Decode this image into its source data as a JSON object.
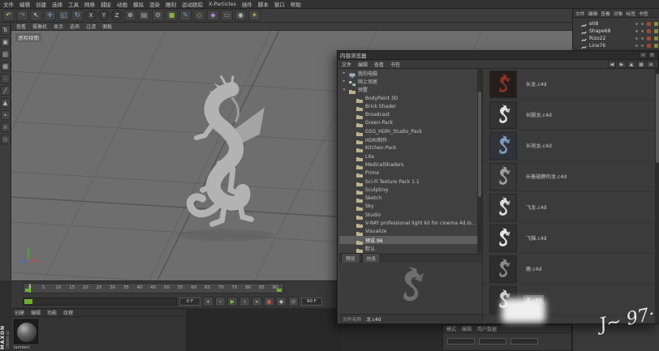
{
  "menubar": {
    "items": [
      "文件",
      "编辑",
      "创建",
      "选择",
      "工具",
      "网格",
      "捕捉",
      "动画",
      "模拟",
      "渲染",
      "雕刻",
      "运动跟踪",
      "X-Particles",
      "插件",
      "脚本",
      "窗口",
      "帮助"
    ]
  },
  "toolbar": {
    "tools": [
      {
        "name": "undo",
        "glyph": "↶",
        "color": "#d6c27a"
      },
      {
        "name": "redo",
        "glyph": "↷",
        "color": "#8f8f8f"
      },
      {
        "name": "live-selection",
        "glyph": "↖",
        "color": "#e2e2e2"
      },
      {
        "name": "move",
        "glyph": "✛",
        "color": "#7fb2e5"
      },
      {
        "name": "scale",
        "glyph": "◱",
        "color": "#7fb2e5"
      },
      {
        "name": "rotate",
        "glyph": "↻",
        "color": "#7fb2e5"
      },
      {
        "name": "axis-x",
        "glyph": "X",
        "color": "#d0d0d0",
        "circle": true
      },
      {
        "name": "axis-y",
        "glyph": "Y",
        "color": "#d0d0d0",
        "circle": true
      },
      {
        "name": "axis-z",
        "glyph": "Z",
        "color": "#d0d0d0",
        "circle": true
      },
      {
        "name": "coordinate-system",
        "glyph": "⊕",
        "color": "#bdbdbd"
      },
      {
        "name": "render-view",
        "glyph": "▤",
        "color": "#aaaaaa"
      },
      {
        "name": "render-settings",
        "glyph": "⚙",
        "color": "#aaaaaa"
      },
      {
        "name": "add-cube",
        "glyph": "■",
        "color": "#86b040"
      },
      {
        "name": "add-spline",
        "glyph": "✎",
        "color": "#6f9fd8"
      },
      {
        "name": "add-generator",
        "glyph": "◇",
        "color": "#86b040"
      },
      {
        "name": "add-deformer",
        "glyph": "◆",
        "color": "#b07fd8"
      },
      {
        "name": "add-floor",
        "glyph": "▭",
        "color": "#b08f5a"
      },
      {
        "name": "add-camera",
        "glyph": "◉",
        "color": "#bdbdbd"
      },
      {
        "name": "add-light",
        "glyph": "☀",
        "color": "#e0c76a"
      }
    ]
  },
  "left_toolbar": {
    "tools": [
      {
        "name": "make-editable",
        "glyph": "⇅"
      },
      {
        "name": "model-mode",
        "glyph": "▣"
      },
      {
        "name": "texture-mode",
        "glyph": "▨"
      },
      {
        "name": "workplane-mode",
        "glyph": "▦"
      },
      {
        "name": "points-mode",
        "glyph": "∴"
      },
      {
        "name": "edges-mode",
        "glyph": "╱"
      },
      {
        "name": "polygons-mode",
        "glyph": "▲"
      },
      {
        "name": "enable-axis",
        "glyph": "⌖"
      },
      {
        "name": "snap",
        "glyph": "∩"
      },
      {
        "name": "viewport-filter",
        "glyph": "◇"
      }
    ]
  },
  "viewport": {
    "menus": [
      "查看",
      "摄像机",
      "显示",
      "选项",
      "过滤",
      "面板"
    ],
    "view_label": "透视视图"
  },
  "timeline": {
    "ticks": [
      "0",
      "5",
      "10",
      "15",
      "20",
      "25",
      "30",
      "35",
      "40",
      "45",
      "50",
      "55",
      "60",
      "65",
      "70",
      "75",
      "80",
      "85",
      "90"
    ],
    "current_frame": "0 F",
    "end_frame": "90 F"
  },
  "transport": {
    "buttons": [
      {
        "name": "go-to-start",
        "glyph": "«",
        "color": "#cccccc"
      },
      {
        "name": "previous-frame",
        "glyph": "‹",
        "color": "#cccccc"
      },
      {
        "name": "play",
        "glyph": "▶",
        "color": "#7cbf3f"
      },
      {
        "name": "next-frame",
        "glyph": "›",
        "color": "#cccccc"
      },
      {
        "name": "go-to-end",
        "glyph": "»",
        "color": "#cccccc"
      },
      {
        "name": "record",
        "glyph": "●",
        "color": "#c05a4a"
      },
      {
        "name": "keyframe",
        "glyph": "◆",
        "color": "#bbbbbb"
      },
      {
        "name": "autokey",
        "glyph": "⊙",
        "color": "#bbbbbb"
      }
    ]
  },
  "material_manager": {
    "menus": [
      "创建",
      "编辑",
      "功能",
      "纹理"
    ],
    "material_name": "lambert"
  },
  "brand": {
    "maxon": "MAXON",
    "cinema": "CINEMA 4D"
  },
  "object_manager": {
    "menus": [
      "文件",
      "编辑",
      "查看",
      "对象",
      "标签",
      "书签"
    ],
    "objects": [
      {
        "name": "e08"
      },
      {
        "name": "Shape68"
      },
      {
        "name": "Rizo22"
      },
      {
        "name": "Line76"
      }
    ]
  },
  "content_browser": {
    "title": "内容浏览器",
    "menus": [
      "文件",
      "编辑",
      "查看",
      "书签"
    ],
    "toolbar_icons": [
      {
        "name": "back-icon",
        "glyph": "◀"
      },
      {
        "name": "forward-icon",
        "glyph": "▶"
      },
      {
        "name": "up-icon",
        "glyph": "▲"
      },
      {
        "name": "list-view-icon",
        "glyph": "▦"
      },
      {
        "name": "menu-icon",
        "glyph": "≡"
      }
    ],
    "window_buttons": [
      {
        "name": "maximize-icon",
        "glyph": "▫"
      },
      {
        "name": "close-icon",
        "glyph": "✕"
      }
    ],
    "tree": [
      {
        "label": "我的电脑",
        "type": "computer",
        "depth": 0,
        "expand": "collapsed"
      },
      {
        "label": "网上邻居",
        "type": "network",
        "depth": 0,
        "expand": "collapsed"
      },
      {
        "label": "预置",
        "type": "folder",
        "depth": 0,
        "expand": "expanded"
      },
      {
        "label": "BodyPaint 3D",
        "type": "folder",
        "depth": 1
      },
      {
        "label": "Brick Shader",
        "type": "folder",
        "depth": 1
      },
      {
        "label": "Broadcast",
        "type": "folder",
        "depth": 1
      },
      {
        "label": "Green-Pack",
        "type": "folder",
        "depth": 1
      },
      {
        "label": "GSG_HDRI_Studio_Pack",
        "type": "folder",
        "depth": 1
      },
      {
        "label": "HDRI制作",
        "type": "folder",
        "depth": 1
      },
      {
        "label": "Kitchen-Pack",
        "type": "folder",
        "depth": 1
      },
      {
        "label": "Lite",
        "type": "folder",
        "depth": 1
      },
      {
        "label": "MedicalShaders",
        "type": "folder",
        "depth": 1
      },
      {
        "label": "Prime",
        "type": "folder",
        "depth": 1
      },
      {
        "label": "Sci-Fi Texture Pack 1.1",
        "type": "folder",
        "depth": 1
      },
      {
        "label": "Sculpting",
        "type": "folder",
        "depth": 1
      },
      {
        "label": "Sketch",
        "type": "folder",
        "depth": 1
      },
      {
        "label": "Sky",
        "type": "folder",
        "depth": 1
      },
      {
        "label": "Studio",
        "type": "folder",
        "depth": 1
      },
      {
        "label": "V-RAY professional light kit for cinema 4d.local",
        "type": "folder",
        "depth": 1
      },
      {
        "label": "Visualize",
        "type": "folder",
        "depth": 1
      },
      {
        "label": "预设.96",
        "type": "folder",
        "depth": 1,
        "selected": true
      },
      {
        "label": "默认",
        "type": "folder",
        "depth": 1
      }
    ],
    "panel_tabs": [
      "预览",
      "信息"
    ],
    "info_label": "文件名称",
    "info_value": "龙.c4d",
    "files": [
      {
        "label": "长龙.c4d",
        "thumb_color": "#8a3326",
        "thumb_bg": "#241d1a"
      },
      {
        "label": "长腿龙.c4d",
        "thumb_color": "#e3e3e3",
        "thumb_bg": "#333333"
      },
      {
        "label": "长袍龙.c4d",
        "thumb_color": "#7e9cc0",
        "thumb_bg": "#30343a"
      },
      {
        "label": "长着翅膀的龙.c4d",
        "thumb_color": "#9f9f9f",
        "thumb_bg": "#383838"
      },
      {
        "label": "飞龙.c4d",
        "thumb_color": "#dddddd",
        "thumb_bg": "#353535"
      },
      {
        "label": "飞猫.c4d",
        "thumb_color": "#e8e8e8",
        "thumb_bg": "#313131"
      },
      {
        "label": "鹿.c4d",
        "thumb_color": "#8a8a8a",
        "thumb_bg": "#2d2d2d"
      },
      {
        "label": "龙.c4d",
        "thumb_color": "#cccccc",
        "thumb_bg": "#2f2f2f",
        "selected": true
      }
    ]
  },
  "attribute_panel": {
    "tabs": [
      "模式",
      "编辑",
      "用户数据"
    ]
  },
  "watermark": {
    "text": "J~ 97·"
  }
}
